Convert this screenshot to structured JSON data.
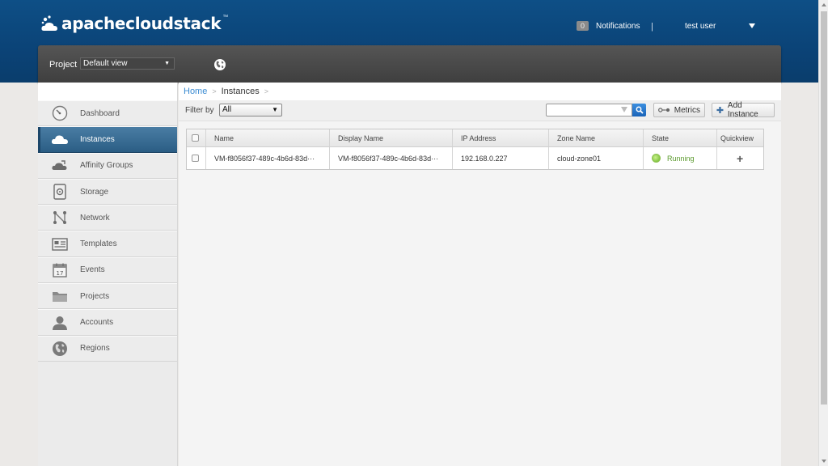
{
  "header": {
    "logo_text": "apachecloudstack",
    "logo_tm": "™",
    "notifications_count": "0",
    "notifications_label": "Notifications",
    "separator": "|",
    "user": "test user"
  },
  "projectbar": {
    "label": "Project",
    "selected": "Default view"
  },
  "sidebar": {
    "items": [
      {
        "label": "Dashboard",
        "icon": "dashboard-icon"
      },
      {
        "label": "Instances",
        "icon": "cloud-icon"
      },
      {
        "label": "Affinity Groups",
        "icon": "affinity-icon"
      },
      {
        "label": "Storage",
        "icon": "storage-icon"
      },
      {
        "label": "Network",
        "icon": "network-icon"
      },
      {
        "label": "Templates",
        "icon": "templates-icon"
      },
      {
        "label": "Events",
        "icon": "calendar-icon"
      },
      {
        "label": "Projects",
        "icon": "folder-icon"
      },
      {
        "label": "Accounts",
        "icon": "user-icon"
      },
      {
        "label": "Regions",
        "icon": "globe-icon"
      }
    ],
    "events_day": "17"
  },
  "breadcrumb": {
    "home": "Home",
    "sep": ">",
    "current": "Instances"
  },
  "toolbar": {
    "filter_label": "Filter by",
    "filter_value": "All",
    "metrics_label": "Metrics",
    "add_label": "Add Instance",
    "search_placeholder": ""
  },
  "table": {
    "headers": [
      "Name",
      "Display Name",
      "IP Address",
      "Zone Name",
      "State",
      "Quickview"
    ],
    "rows": [
      {
        "name": "VM-f8056f37-489c-4b6d-83d···",
        "display_name": "VM-f8056f37-489c-4b6d-83d···",
        "ip": "192.168.0.227",
        "zone": "cloud-zone01",
        "state": "Running",
        "quickview": "+"
      }
    ]
  },
  "colors": {
    "header_blue": "#0e4f86",
    "active_nav": "#2b5d84",
    "link_blue": "#3a8bd2",
    "running_green": "#5a9a2c"
  }
}
